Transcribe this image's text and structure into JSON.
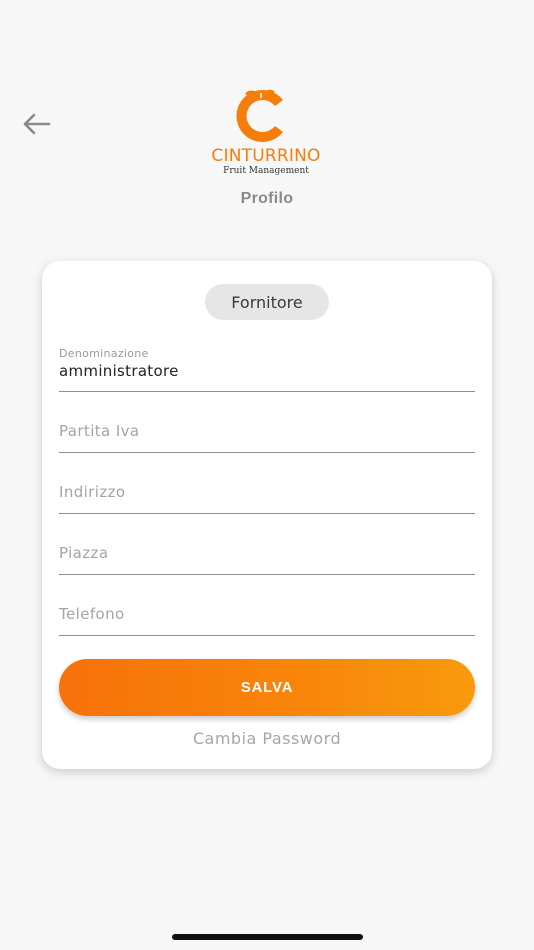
{
  "header": {
    "back_icon": "arrow-left-icon",
    "brand_name": "CINTURRINO",
    "brand_tagline": "Fruit Management",
    "title": "Profilo"
  },
  "colors": {
    "accent": "#f57d0b",
    "background": "#f7f7f7",
    "card": "#ffffff",
    "chip": "#e6e6e6"
  },
  "form": {
    "role_chip": "Fornitore",
    "fields": [
      {
        "label": "Denominazione",
        "value": "amministratore",
        "placeholder": ""
      },
      {
        "label": "",
        "value": "",
        "placeholder": "Partita Iva"
      },
      {
        "label": "",
        "value": "",
        "placeholder": "Indirizzo"
      },
      {
        "label": "",
        "value": "",
        "placeholder": "Piazza"
      },
      {
        "label": "",
        "value": "",
        "placeholder": "Telefono"
      }
    ],
    "save_label": "SALVA",
    "change_password_label": "Cambia Password"
  }
}
